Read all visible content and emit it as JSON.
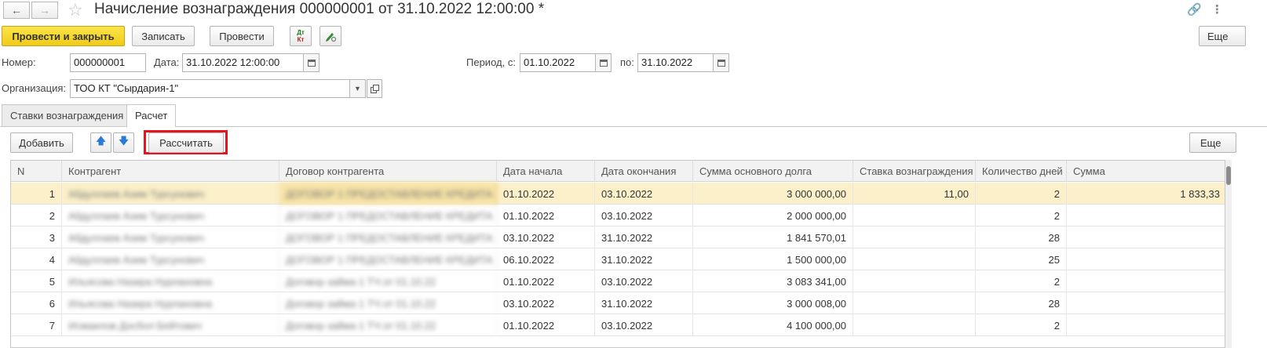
{
  "titlebar": {
    "back_icon": "←",
    "forward_icon": "→",
    "star_icon": "☆",
    "title": "Начисление вознаграждения 000000001 от 31.10.2022 12:00:00 *",
    "link_icon": "🔗",
    "menu_icon": "⋮"
  },
  "toolbar": {
    "post_close": "Провести и закрыть",
    "save": "Записать",
    "post": "Провести",
    "dt_kt_top": "Дт",
    "dt_kt_bottom": "Кт",
    "more": "Еще"
  },
  "form": {
    "number_label": "Номер:",
    "number_value": "000000001",
    "date_label": "Дата:",
    "date_value": "31.10.2022 12:00:00",
    "period_label": "Период, с:",
    "period_from": "01.10.2022",
    "period_to_label": "по:",
    "period_to": "31.10.2022",
    "org_label": "Организация:",
    "org_value": "ТОО КТ \"Сырдария-1\""
  },
  "tabs": [
    {
      "label": "Ставки вознаграждения"
    },
    {
      "label": "Расчет"
    }
  ],
  "table_toolbar": {
    "add": "Добавить",
    "up_icon": "🡅",
    "down_icon": "🡇",
    "calculate": "Рассчитать",
    "more": "Еще"
  },
  "table": {
    "columns": [
      "N",
      "Контрагент",
      "Договор контрагента",
      "Дата начала",
      "Дата окончания",
      "Сумма основного долга",
      "Ставка вознаграждения",
      "Количество дней",
      "Сумма"
    ],
    "rows": [
      {
        "n": "1",
        "kontragent": "Абдуллаев Азим Турсунович",
        "dogovor": "ДОГОВОР 1 ПРЕДОСТАВЛЕНИЕ КРЕДИТА",
        "start": "01.10.2022",
        "end": "03.10.2022",
        "debt": "3 000 000,00",
        "rate": "11,00",
        "days": "2",
        "sum": "1 833,33"
      },
      {
        "n": "2",
        "kontragent": "Абдуллаев Азим Турсунович",
        "dogovor": "ДОГОВОР 1 ПРЕДОСТАВЛЕНИЕ КРЕДИТА",
        "start": "01.10.2022",
        "end": "03.10.2022",
        "debt": "2 000 000,00",
        "rate": "",
        "days": "2",
        "sum": ""
      },
      {
        "n": "3",
        "kontragent": "Абдуллаев Азим Турсунович",
        "dogovor": "ДОГОВОР 1 ПРЕДОСТАВЛЕНИЕ КРЕДИТА",
        "start": "03.10.2022",
        "end": "31.10.2022",
        "debt": "1 841 570,01",
        "rate": "",
        "days": "28",
        "sum": ""
      },
      {
        "n": "4",
        "kontragent": "Абдуллаев Азим Турсунович",
        "dogovor": "ДОГОВОР 1 ПРЕДОСТАВЛЕНИЕ КРЕДИТА",
        "start": "06.10.2022",
        "end": "31.10.2022",
        "debt": "1 500 000,00",
        "rate": "",
        "days": "25",
        "sum": ""
      },
      {
        "n": "5",
        "kontragent": "Ильясова Назира Нурлановна",
        "dogovor": "Договор займа 1 ТЧ      от 01.10.22",
        "start": "01.10.2022",
        "end": "03.10.2022",
        "debt": "3 083 341,00",
        "rate": "",
        "days": "2",
        "sum": ""
      },
      {
        "n": "6",
        "kontragent": "Ильясова Назира Нурлановна",
        "dogovor": "Договор займа 1 ТЧ      от 01.10.22",
        "start": "03.10.2022",
        "end": "31.10.2022",
        "debt": "3 000 008,00",
        "rate": "",
        "days": "28",
        "sum": ""
      },
      {
        "n": "7",
        "kontragent": "Исмаилов Досбол Бейтович",
        "dogovor": "Договор займа 1 ТЧ      от 01.10.22",
        "start": "01.10.2022",
        "end": "03.10.2022",
        "debt": "4 100 000,00",
        "rate": "",
        "days": "2",
        "sum": ""
      }
    ]
  },
  "colors": {
    "primary_button": "#f5d832",
    "selected_row": "#fbf0c9",
    "highlight_border": "#e8141b"
  }
}
